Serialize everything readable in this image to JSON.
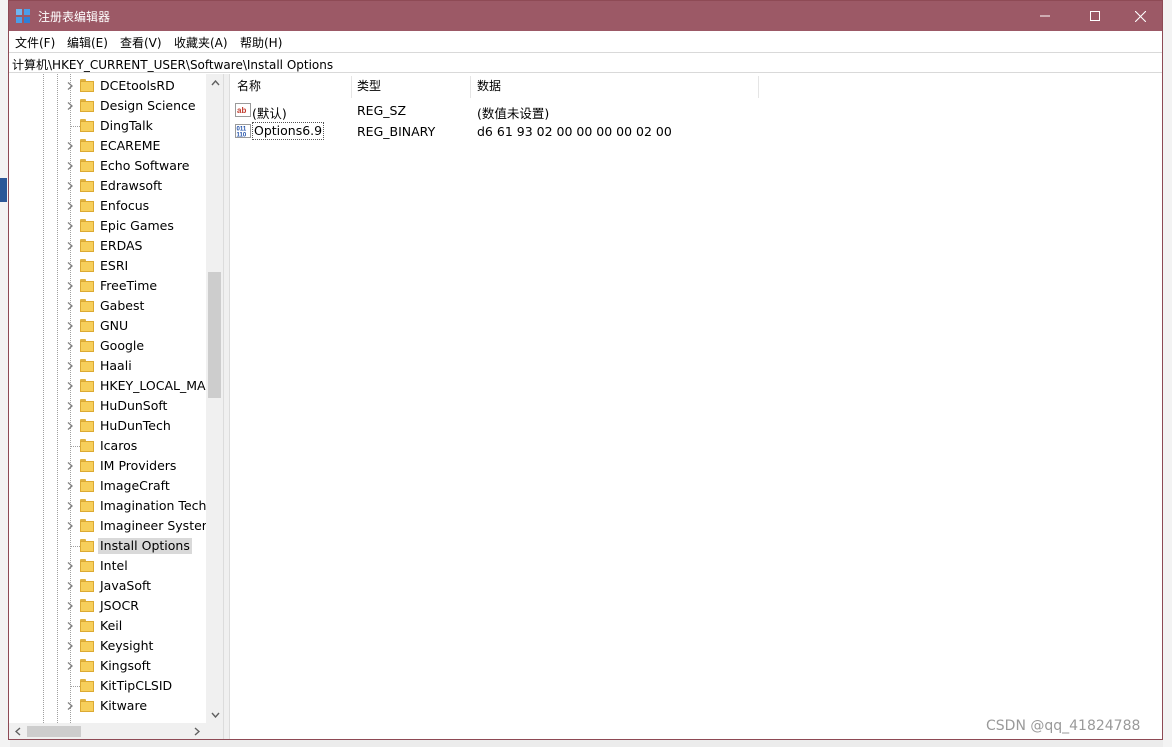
{
  "window": {
    "title": "注册表编辑器"
  },
  "menu": [
    "文件(F)",
    "编辑(E)",
    "查看(V)",
    "收藏夹(A)",
    "帮助(H)"
  ],
  "address": "计算机\\HKEY_CURRENT_USER\\Software\\Install Options",
  "tree": {
    "items": [
      {
        "label": "DCEtoolsRD",
        "expandable": true
      },
      {
        "label": "Design Science",
        "expandable": true
      },
      {
        "label": "DingTalk",
        "expandable": false
      },
      {
        "label": "ECAREME",
        "expandable": true
      },
      {
        "label": "Echo Software",
        "expandable": true
      },
      {
        "label": "Edrawsoft",
        "expandable": true
      },
      {
        "label": "Enfocus",
        "expandable": true
      },
      {
        "label": "Epic Games",
        "expandable": true
      },
      {
        "label": "ERDAS",
        "expandable": true
      },
      {
        "label": "ESRI",
        "expandable": true
      },
      {
        "label": "FreeTime",
        "expandable": true
      },
      {
        "label": "Gabest",
        "expandable": true
      },
      {
        "label": "GNU",
        "expandable": true
      },
      {
        "label": "Google",
        "expandable": true
      },
      {
        "label": "Haali",
        "expandable": true
      },
      {
        "label": "HKEY_LOCAL_MAC",
        "expandable": true
      },
      {
        "label": "HuDunSoft",
        "expandable": true
      },
      {
        "label": "HuDunTech",
        "expandable": true
      },
      {
        "label": "Icaros",
        "expandable": false
      },
      {
        "label": "IM Providers",
        "expandable": true
      },
      {
        "label": "ImageCraft",
        "expandable": true
      },
      {
        "label": "Imagination Techn",
        "expandable": true
      },
      {
        "label": "Imagineer Systems",
        "expandable": true
      },
      {
        "label": "Install Options",
        "expandable": false,
        "selected": true
      },
      {
        "label": "Intel",
        "expandable": true
      },
      {
        "label": "JavaSoft",
        "expandable": true
      },
      {
        "label": "JSOCR",
        "expandable": true
      },
      {
        "label": "Keil",
        "expandable": true
      },
      {
        "label": "Keysight",
        "expandable": true
      },
      {
        "label": "Kingsoft",
        "expandable": true
      },
      {
        "label": "KitTipCLSID",
        "expandable": false
      },
      {
        "label": "Kitware",
        "expandable": true
      }
    ]
  },
  "list": {
    "columns": [
      "名称",
      "类型",
      "数据"
    ],
    "rows": [
      {
        "icon": "string-value-icon",
        "name": "(默认)",
        "type": "REG_SZ",
        "data": "(数值未设置)"
      },
      {
        "icon": "binary-value-icon",
        "name": "Options6.9",
        "type": "REG_BINARY",
        "data": "d6 61 93 02 00 00 00 00 02 00",
        "focused": true
      }
    ]
  },
  "watermark": "CSDN @qq_41824788",
  "colors": {
    "titlebar": "#9c5966",
    "selection": "#d9d9d9",
    "folder": "#f7cf5b"
  }
}
